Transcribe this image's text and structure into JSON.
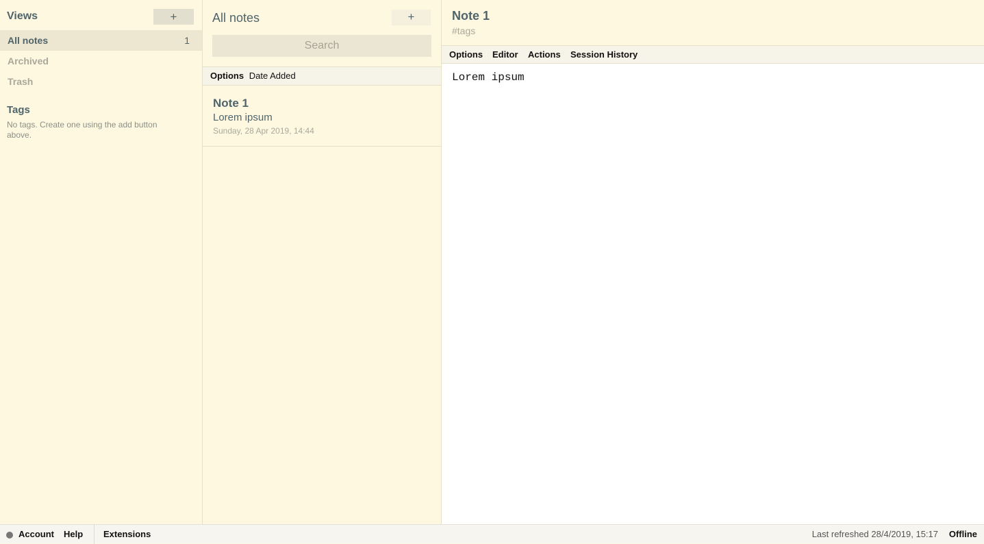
{
  "sidebar": {
    "views_header": "Views",
    "add_icon": "plus-icon",
    "add_label": "+",
    "views": [
      {
        "label": "All notes",
        "count": "1"
      },
      {
        "label": "Archived"
      },
      {
        "label": "Trash"
      }
    ],
    "tags_header": "Tags",
    "tags_empty": "No tags. Create one using the add button above."
  },
  "notes_list": {
    "title": "All notes",
    "new_note_icon": "plus-icon",
    "new_note_label": "+",
    "search_placeholder": "Search",
    "options_label": "Options",
    "sort_label": "Date Added",
    "notes": [
      {
        "title": "Note 1",
        "preview": "Lorem ipsum",
        "date": "Sunday, 28 Apr 2019, 14:44"
      }
    ]
  },
  "editor": {
    "title": "Note 1",
    "tags_placeholder": "#tags",
    "menu": [
      "Options",
      "Editor",
      "Actions",
      "Session History"
    ],
    "content": "Lorem ipsum"
  },
  "footer": {
    "account": "Account",
    "help": "Help",
    "extensions": "Extensions",
    "last_refreshed": "Last refreshed 28/4/2019, 15:17",
    "status": "Offline"
  },
  "colors": {
    "background": "#fef8e1",
    "accent_text": "#50646b",
    "muted_text": "#a9a89a",
    "editor_background": "#ffffff"
  }
}
